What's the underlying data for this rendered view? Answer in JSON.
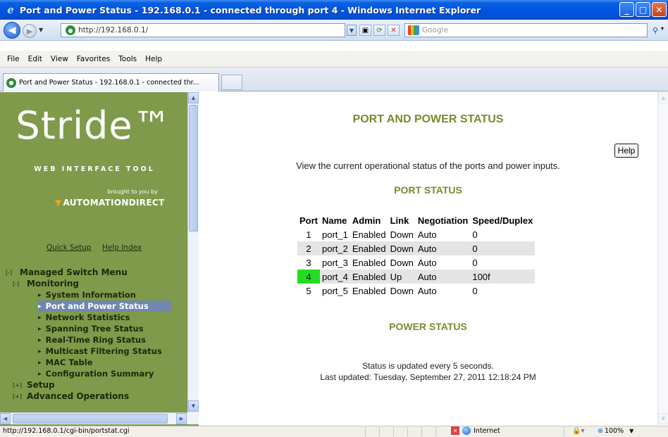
{
  "window": {
    "title": "Port and Power Status - 192.168.0.1 - connected through port 4 - Windows Internet Explorer"
  },
  "address_bar": {
    "url": "http://192.168.0.1/",
    "search_placeholder": "Google"
  },
  "menu": [
    "File",
    "Edit",
    "View",
    "Favorites",
    "Tools",
    "Help"
  ],
  "tab": {
    "label": "Port and Power Status - 192.168.0.1 - connected thr..."
  },
  "sidebar": {
    "logo_text": "Stride",
    "logo_tm": "™",
    "logo_subtitle": "WEB INTERFACE TOOL",
    "brought_by": "brought to you by",
    "vendor": "AUTOMATIONDIRECT",
    "quick_setup": "Quick Setup",
    "help_index": "Help Index",
    "tree": {
      "managed_switch": {
        "expander": "[-]",
        "label": "Managed Switch Menu"
      },
      "monitoring": {
        "expander": "[-]",
        "label": "Monitoring"
      },
      "monitoring_items": [
        "System Information",
        "Port and Power Status",
        "Network Statistics",
        "Spanning Tree Status",
        "Real-Time Ring Status",
        "Multicast Filtering Status",
        "MAC Table",
        "Configuration Summary"
      ],
      "selected_index": 1,
      "setup": {
        "expander": "[+]",
        "label": "Setup"
      },
      "advanced": {
        "expander": "[+]",
        "label": "Advanced Operations"
      }
    }
  },
  "main": {
    "title": "PORT AND POWER STATUS",
    "help_label": "Help",
    "description": "View the current operational status of the ports and power inputs.",
    "port_status_heading": "PORT STATUS",
    "columns": [
      "Port",
      "Name",
      "Admin",
      "Link",
      "Negotiation",
      "Speed/Duplex"
    ],
    "ports": [
      {
        "port": "1",
        "name": "port_1",
        "admin": "Enabled",
        "link": "Down",
        "negotiation": "Auto",
        "speed": "0"
      },
      {
        "port": "2",
        "name": "port_2",
        "admin": "Enabled",
        "link": "Down",
        "negotiation": "Auto",
        "speed": "0"
      },
      {
        "port": "3",
        "name": "port_3",
        "admin": "Enabled",
        "link": "Down",
        "negotiation": "Auto",
        "speed": "0"
      },
      {
        "port": "4",
        "name": "port_4",
        "admin": "Enabled",
        "link": "Up",
        "negotiation": "Auto",
        "speed": "100f"
      },
      {
        "port": "5",
        "name": "port_5",
        "admin": "Enabled",
        "link": "Down",
        "negotiation": "Auto",
        "speed": "0"
      }
    ],
    "power_status_heading": "POWER STATUS",
    "update_note": "Status is updated every 5 seconds.",
    "last_updated": "Last updated: Tuesday, September 27, 2011 12:18:24 PM"
  },
  "status_bar": {
    "url": "http://192.168.0.1/cgi-bin/portstat.cgi",
    "zone": "Internet",
    "zoom": "100%"
  },
  "colors": {
    "sidebar_bg": "#7f9a4a",
    "heading": "#7a8a2e",
    "link_up": "#22dd22",
    "selected_item": "#7087ae"
  }
}
